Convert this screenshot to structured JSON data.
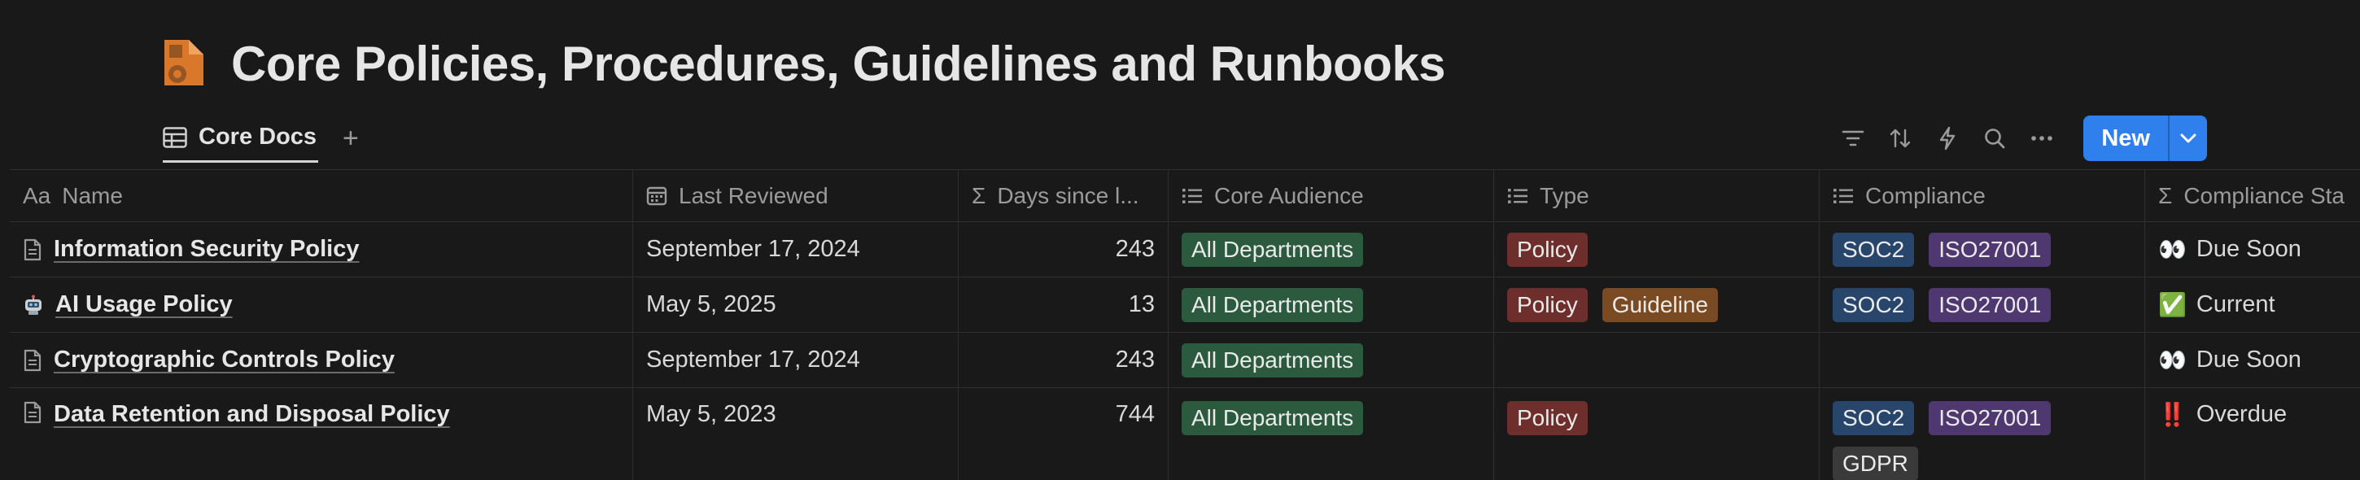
{
  "page": {
    "title": "Core Policies, Procedures, Guidelines and Runbooks",
    "icon": "document-gear-icon",
    "accent": "#d9772a"
  },
  "view": {
    "tab_label": "Core Docs",
    "tab_icon": "table-icon",
    "add_label": "+"
  },
  "toolbar": {
    "icons": [
      "filter-icon",
      "sort-icon",
      "lightning-icon",
      "search-icon",
      "more-icon"
    ],
    "new_label": "New",
    "new_color": "#2f80ed"
  },
  "table": {
    "columns": [
      {
        "label": "Name",
        "icon": "Aa"
      },
      {
        "label": "Last Reviewed",
        "icon": "calendar-icon"
      },
      {
        "label": "Days since l...",
        "icon": "Σ"
      },
      {
        "label": "Core Audience",
        "icon": "list-icon"
      },
      {
        "label": "Type",
        "icon": "list-icon"
      },
      {
        "label": "Compliance",
        "icon": "list-icon"
      },
      {
        "label": "Compliance Sta",
        "icon": "Σ"
      }
    ],
    "rows": [
      {
        "name": "Information Security Policy",
        "icon": "document-icon",
        "last_reviewed": "September 17, 2024",
        "days": "243",
        "audience": [
          "All Departments"
        ],
        "type": [
          "Policy"
        ],
        "compliance": [
          "SOC2",
          "ISO27001"
        ],
        "status_emoji": "👀",
        "status": "Due Soon"
      },
      {
        "name": "AI Usage Policy",
        "icon": "robot-icon",
        "last_reviewed": "May 5, 2025",
        "days": "13",
        "audience": [
          "All Departments"
        ],
        "type": [
          "Policy",
          "Guideline"
        ],
        "compliance": [
          "SOC2",
          "ISO27001"
        ],
        "status_emoji": "✅",
        "status": "Current"
      },
      {
        "name": "Cryptographic Controls Policy",
        "icon": "document-icon",
        "last_reviewed": "September 17, 2024",
        "days": "243",
        "audience": [
          "All Departments"
        ],
        "type": [],
        "compliance": [],
        "status_emoji": "👀",
        "status": "Due Soon"
      },
      {
        "name": "Data Retention and Disposal Policy",
        "icon": "document-icon",
        "last_reviewed": "May 5, 2023",
        "days": "744",
        "audience": [
          "All Departments"
        ],
        "type": [
          "Policy"
        ],
        "compliance": [
          "SOC2",
          "ISO27001",
          "GDPR"
        ],
        "status_emoji": "‼️",
        "status": "Overdue"
      }
    ]
  }
}
